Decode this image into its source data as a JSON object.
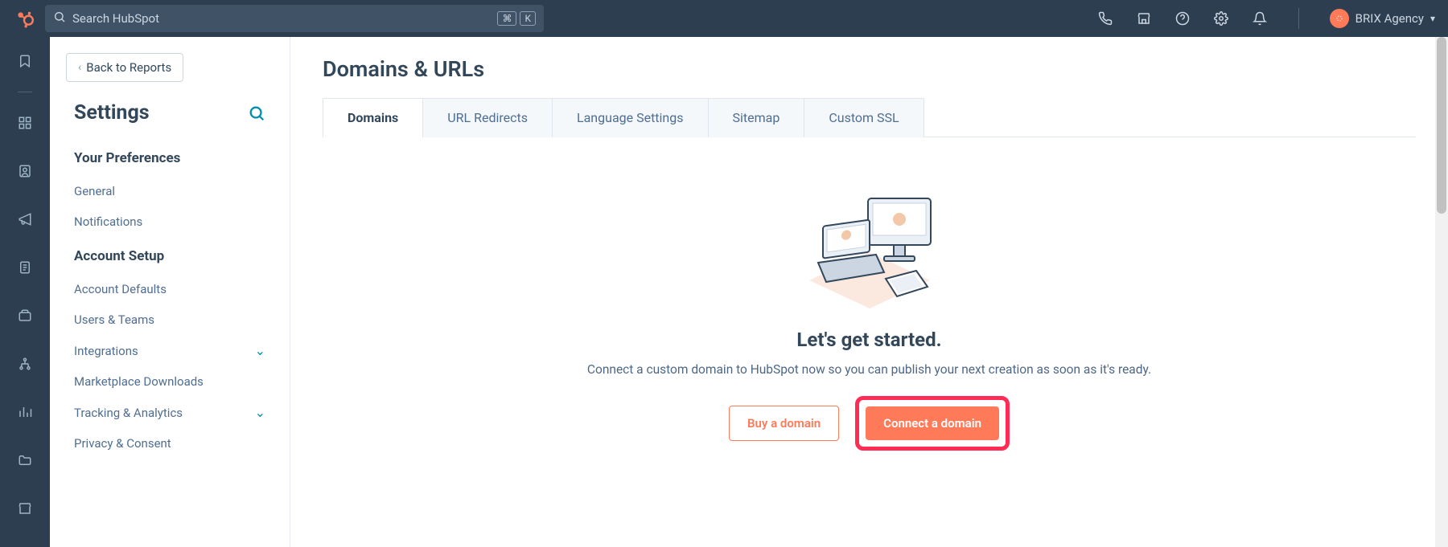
{
  "topbar": {
    "search_placeholder": "Search HubSpot",
    "kbd1": "⌘",
    "kbd2": "K",
    "account_name": "BRIX Agency"
  },
  "sidebar": {
    "back_label": "Back to Reports",
    "title": "Settings",
    "section_prefs": "Your Preferences",
    "prefs_items": [
      "General",
      "Notifications"
    ],
    "section_account": "Account Setup",
    "account_items": [
      {
        "label": "Account Defaults",
        "expandable": false
      },
      {
        "label": "Users & Teams",
        "expandable": false
      },
      {
        "label": "Integrations",
        "expandable": true
      },
      {
        "label": "Marketplace Downloads",
        "expandable": false
      },
      {
        "label": "Tracking & Analytics",
        "expandable": true
      },
      {
        "label": "Privacy & Consent",
        "expandable": false
      }
    ]
  },
  "main": {
    "page_title": "Domains & URLs",
    "tabs": [
      "Domains",
      "URL Redirects",
      "Language Settings",
      "Sitemap",
      "Custom SSL"
    ],
    "active_tab": 0,
    "empty_title": "Let's get started.",
    "empty_sub": "Connect a custom domain to HubSpot now so you can publish your next creation as soon as it's ready.",
    "btn_buy": "Buy a domain",
    "btn_connect": "Connect a domain"
  }
}
